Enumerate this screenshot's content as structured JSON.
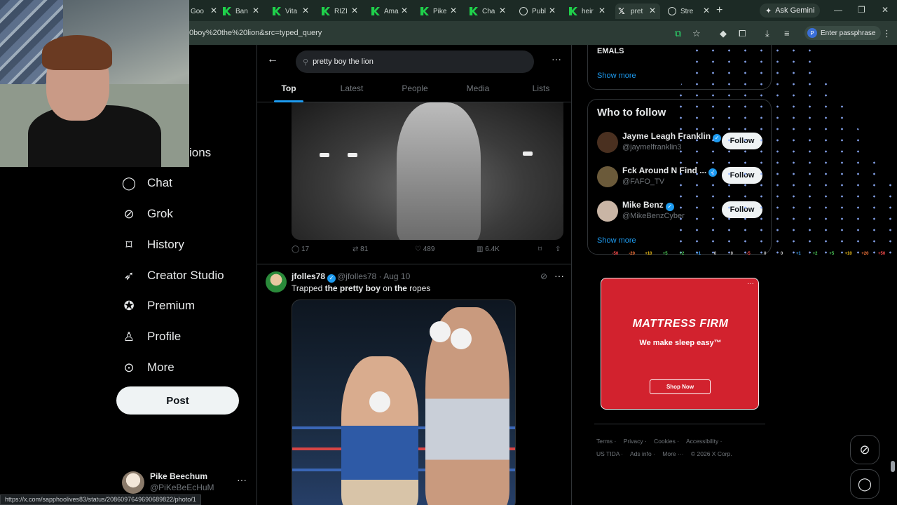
{
  "browser": {
    "tabs": [
      {
        "label": "Goo",
        "icon": "globe-icon"
      },
      {
        "label": "Ban",
        "icon": "kick-icon"
      },
      {
        "label": "Vita",
        "icon": "kick-icon"
      },
      {
        "label": "RIZI",
        "icon": "kick-icon"
      },
      {
        "label": "Ama",
        "icon": "kick-icon"
      },
      {
        "label": "Pike",
        "icon": "kick-icon"
      },
      {
        "label": "Cha",
        "icon": "kick-icon"
      },
      {
        "label": "Publ",
        "icon": "globe-icon"
      },
      {
        "label": "heir",
        "icon": "kick-icon"
      },
      {
        "label": "pret",
        "icon": "x-logo-icon",
        "active": true
      },
      {
        "label": "Stre",
        "icon": "globe-icon"
      }
    ],
    "ask_gemini": "Ask Gemini",
    "url": "0boy%20the%20lion&src=typed_query",
    "passphrase_label": "Enter passphrase",
    "passphrase_badge": "P",
    "status_url": "https://x.com/sapphoolives83/status/2086097649690689822/photo/1"
  },
  "nav": {
    "partial_label": "ions",
    "items": [
      {
        "label": "Chat",
        "icon": "chat-bubble-icon"
      },
      {
        "label": "Grok",
        "icon": "grok-icon"
      },
      {
        "label": "History",
        "icon": "bookmark-icon"
      },
      {
        "label": "Creator Studio",
        "icon": "rocket-icon"
      },
      {
        "label": "Premium",
        "icon": "verified-badge-icon"
      },
      {
        "label": "Profile",
        "icon": "person-icon"
      },
      {
        "label": "More",
        "icon": "more-circle-icon"
      }
    ],
    "post_label": "Post",
    "account": {
      "name": "Pike Beechum",
      "handle": "@PiKeBeEcHuM"
    }
  },
  "search": {
    "query": "pretty boy the lion",
    "tabs": [
      "Top",
      "Latest",
      "People",
      "Media",
      "Lists"
    ],
    "active_tab": "Top"
  },
  "tweet1": {
    "replies": "17",
    "reposts": "81",
    "likes": "489",
    "views": "6.4K"
  },
  "tweet2": {
    "name": "jfolles78",
    "handle": "@jfolles78 · Aug 10",
    "text_parts": [
      "Trapped ",
      "the pretty boy",
      " on ",
      "the",
      " ropes"
    ]
  },
  "sidebar": {
    "top_card_title": "EMALS",
    "show_more": "Show more",
    "who_to_follow_title": "Who to follow",
    "follow_label": "Follow",
    "suggestions": [
      {
        "name": "Jayme Leagh Franklin",
        "handle": "@jaymelfranklin3",
        "verified": true,
        "color": "#4a3020"
      },
      {
        "name": "Fck Around N Find ...",
        "handle": "@FAFO_TV",
        "verified": true,
        "color": "#6b5a3a"
      },
      {
        "name": "Mike Benz",
        "handle": "@MikeBenzCyber",
        "verified": true,
        "color": "#c9b5a5"
      }
    ],
    "show_more_2": "Show more",
    "meter": [
      "-50",
      "-20",
      "+10",
      "+5",
      "+2",
      "+1",
      "0",
      "0",
      "-5",
      "0",
      "0",
      "+1",
      "+2",
      "+5",
      "+10",
      "+20",
      "+50"
    ]
  },
  "ad": {
    "brand": "MATTRESS FIRM",
    "tagline": "We make sleep easy™",
    "cta": "Shop Now"
  },
  "footer": {
    "links": [
      "Terms ·",
      "Privacy ·",
      "Cookies ·",
      "Accessibility ·",
      "US TIDA ·",
      "Ads info ·",
      "More ···",
      "© 2026 X Corp."
    ]
  }
}
